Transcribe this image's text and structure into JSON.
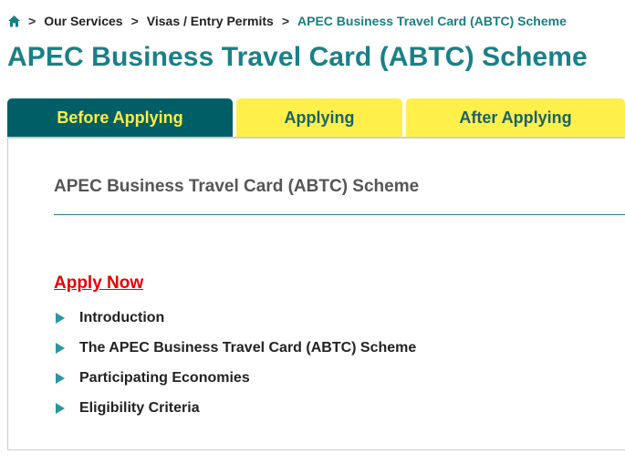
{
  "breadcrumb": {
    "home_icon": "home-icon",
    "separator": ">",
    "items": [
      "Our Services",
      "Visas / Entry Permits",
      "APEC Business Travel Card (ABTC) Scheme"
    ]
  },
  "page_title": "APEC Business Travel Card (ABTC) Scheme",
  "tabs": [
    {
      "label": "Before Applying",
      "active": true
    },
    {
      "label": "Applying",
      "active": false
    },
    {
      "label": "After Applying",
      "active": false
    }
  ],
  "panel": {
    "title": "APEC Business Travel Card (ABTC) Scheme",
    "apply_link": "Apply Now",
    "items": [
      "Introduction",
      "The APEC Business Travel Card (ABTC) Scheme",
      "Participating Economies",
      "Eligibility Criteria"
    ]
  },
  "colors": {
    "title_teal": "#1a8086",
    "active_tab_bg": "#005f66",
    "active_tab_text": "#ffee45",
    "inactive_tab_bg": "#ffef4a",
    "link_red": "#e60000",
    "bullet_teal": "#2a97a0"
  }
}
